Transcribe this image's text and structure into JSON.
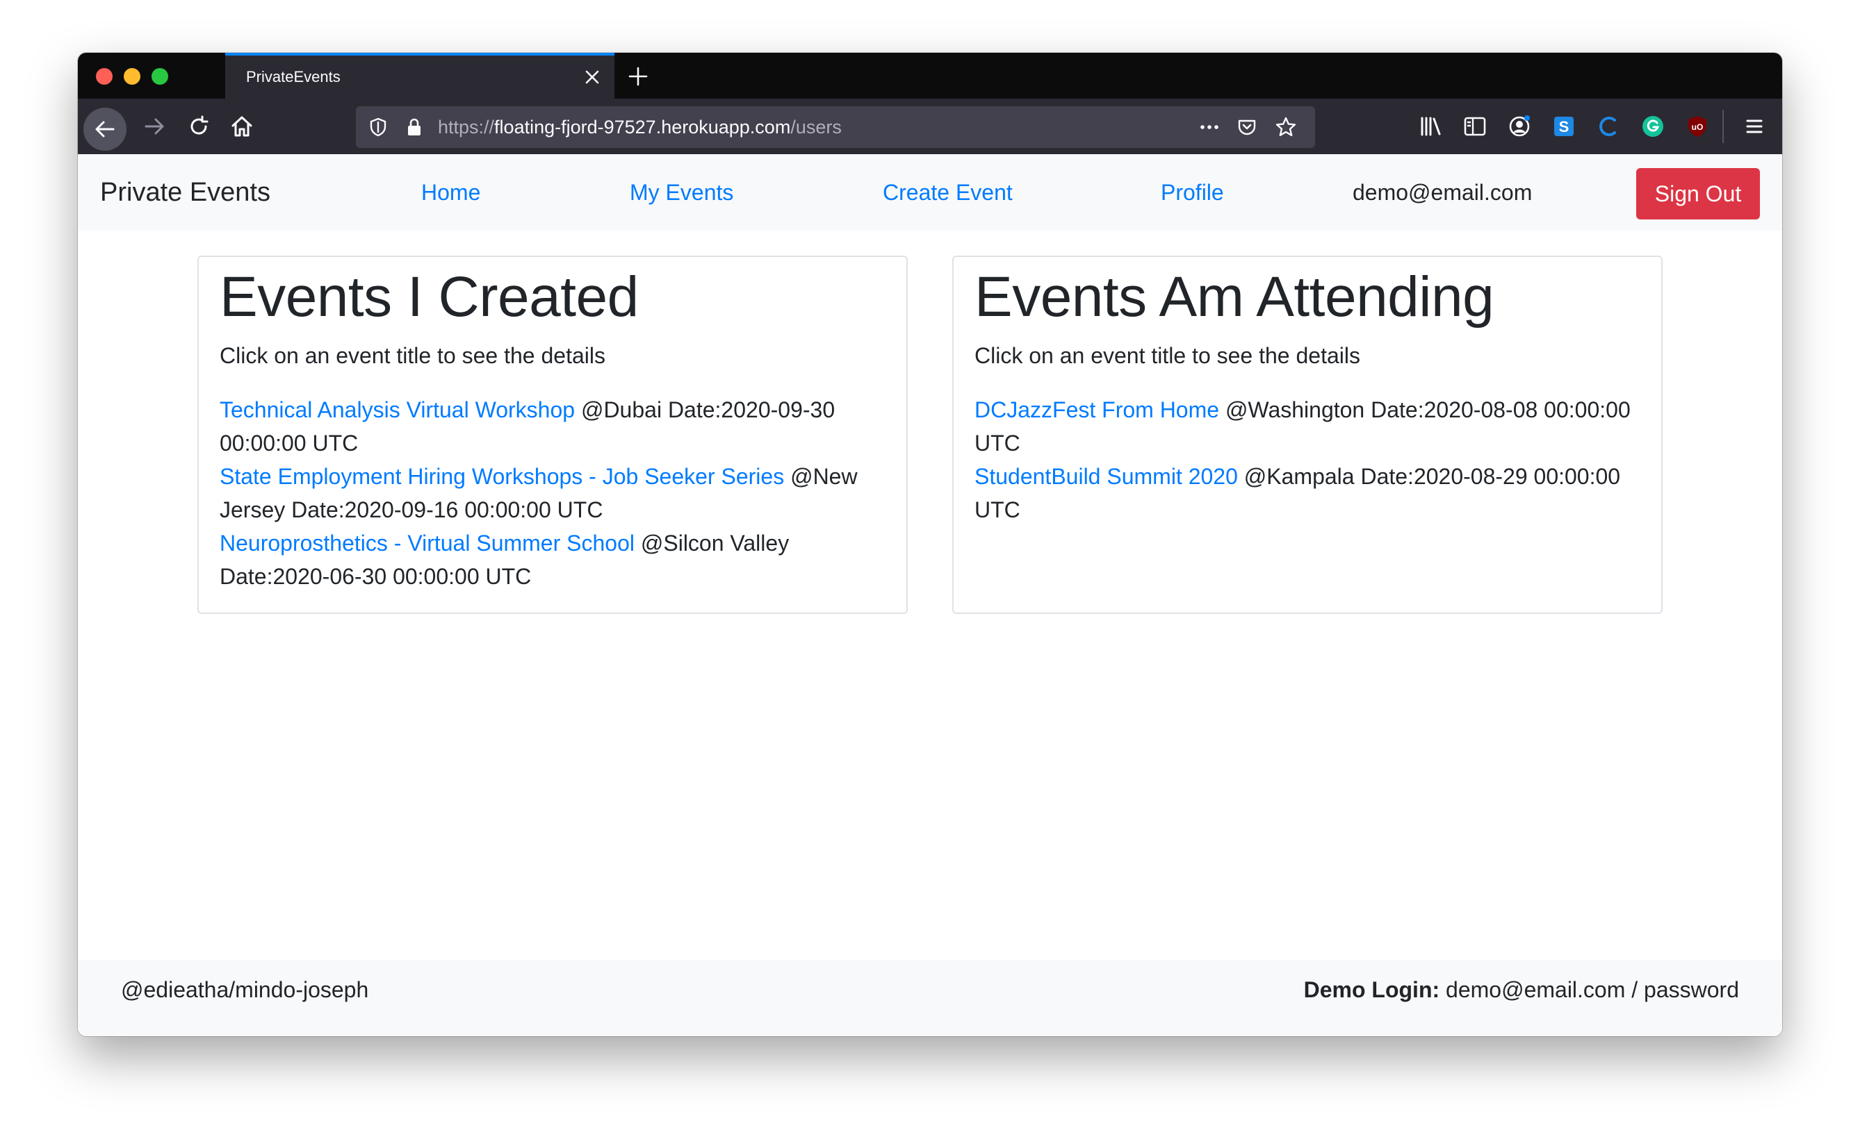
{
  "browser": {
    "tab_title": "PrivateEvents",
    "url_scheme": "https://",
    "url_host": "floating-fjord-97527.herokuapp.com",
    "url_path": "/users"
  },
  "site_nav": {
    "brand": "Private Events",
    "links": [
      "Home",
      "My Events",
      "Create Event",
      "Profile"
    ],
    "user_email": "demo@email.com",
    "sign_out": "Sign Out"
  },
  "created": {
    "heading": "Events I Created",
    "hint": "Click on an event title to see the details",
    "events": [
      {
        "title": "Technical Analysis Virtual Workshop",
        "details": " @Dubai Date:2020-09-30 00:00:00 UTC"
      },
      {
        "title": "State Employment Hiring Workshops - Job Seeker Series",
        "details": " @New Jersey Date:2020-09-16 00:00:00 UTC"
      },
      {
        "title": "Neuroprosthetics - Virtual Summer School",
        "details": " @Silcon Valley Date:2020-06-30 00:00:00 UTC"
      }
    ]
  },
  "attending": {
    "heading": "Events Am Attending",
    "hint": "Click on an event title to see the details",
    "events": [
      {
        "title": "DCJazzFest From Home",
        "details": " @Washington Date:2020-08-08 00:00:00 UTC"
      },
      {
        "title": "StudentBuild Summit 2020",
        "details": " @Kampala Date:2020-08-29 00:00:00 UTC"
      }
    ]
  },
  "footer": {
    "left": "@edieatha/mindo-joseph",
    "demo_label": "Demo Login:",
    "demo_value": " demo@email.com / password"
  },
  "colors": {
    "link": "#007bff",
    "danger": "#dc3545",
    "navbar_bg": "#f8f9fa",
    "text": "#212529"
  },
  "icons": {
    "toolbar": [
      "library-icon",
      "sidebar-icon",
      "account-icon",
      "extension-s-icon",
      "extension-c-icon",
      "grammarly-icon",
      "ublock-icon",
      "menu-icon"
    ]
  }
}
